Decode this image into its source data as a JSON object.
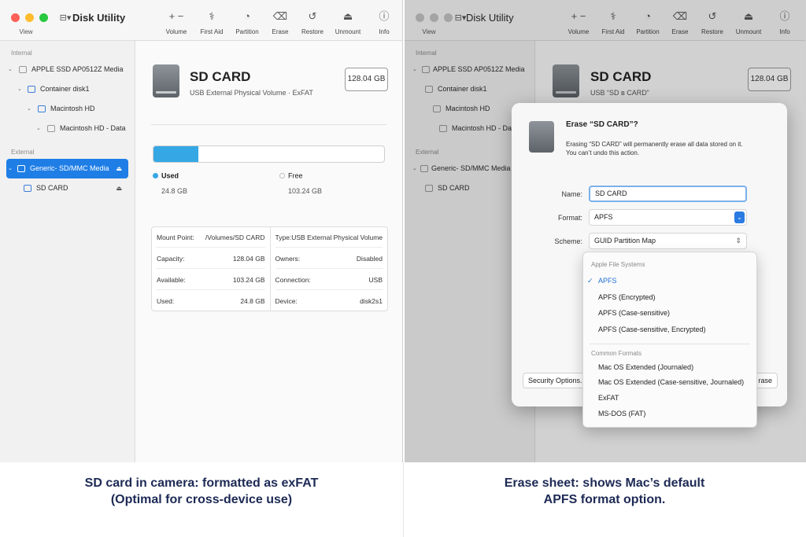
{
  "app": {
    "title": "Disk Utility",
    "view_label": "View",
    "toolbar": [
      {
        "label": "Volume",
        "icon": "plus-minus-icon"
      },
      {
        "label": "First Aid",
        "icon": "stethoscope-icon"
      },
      {
        "label": "Partition",
        "icon": "pie-icon"
      },
      {
        "label": "Erase",
        "icon": "erase-icon"
      },
      {
        "label": "Restore",
        "icon": "restore-icon"
      },
      {
        "label": "Unmount",
        "icon": "unmount-icon"
      },
      {
        "label": "Info",
        "icon": "info-icon"
      }
    ]
  },
  "sidebar": {
    "internal_header": "Internal",
    "external_header": "External",
    "internal_items": [
      {
        "label": "APPLE SSD AP0512Z Media"
      },
      {
        "label": "Container disk1"
      },
      {
        "label": "Macintosh HD"
      },
      {
        "label": "Macintosh HD - Data"
      }
    ],
    "external_items": [
      {
        "label": "Generic- SD/MMC Media"
      },
      {
        "label": "SD CARD"
      }
    ],
    "right_truncated": {
      "external_item_1": "Generic- SD/MMC Media"
    }
  },
  "volume": {
    "name": "SD CARD",
    "subtitle": "USB External Physical Volume  ·  ExFAT",
    "subtitle_obscured": "USB “SD ʙ CARD”",
    "capacity_badge": "128.04 GB",
    "used_fraction": 0.194,
    "used_label": "Used",
    "used_value": "24.8 GB",
    "free_label": "Free",
    "free_value": "103.24 GB",
    "used_color": "#35a7e5",
    "free_color": "#e8e8e8"
  },
  "info": {
    "left": [
      {
        "k": "Mount Point:",
        "v": "/Volumes/SD CARD"
      },
      {
        "k": "Capacity:",
        "v": "128.04 GB"
      },
      {
        "k": "Available:",
        "v": "103.24 GB"
      },
      {
        "k": "Used:",
        "v": "24.8 GB"
      }
    ],
    "right": [
      {
        "k": "Type:",
        "v": "USB External Physical Volume"
      },
      {
        "k": "Owners:",
        "v": "Disabled"
      },
      {
        "k": "Connection:",
        "v": "USB"
      },
      {
        "k": "Device:",
        "v": "disk2s1"
      }
    ]
  },
  "erase_sheet": {
    "title": "Erase “SD CARD”?",
    "description": "Erasing “SD CARD” will permanently erase all data stored on it. You can’t undo this action.",
    "name_label": "Name:",
    "name_value": "SD CARD",
    "format_label": "Format:",
    "format_value": "APFS",
    "scheme_label": "Scheme:",
    "scheme_value": "GUID Partition Map",
    "security_button": "Security Options...",
    "erase_button": "Erase",
    "erase_button_visible": "rase"
  },
  "format_menu": {
    "apple_header": "Apple File Systems",
    "apple_items": [
      "APFS",
      "APFS (Encrypted)",
      "APFS (Case-sensitive)",
      "APFS (Case-sensitive, Encrypted)"
    ],
    "common_header": "Common Formats",
    "common_items": [
      "Mac OS Extended (Journaled)",
      "Mac OS Extended (Case-sensitive, Journaled)",
      "ExFAT",
      "MS-DOS (FAT)"
    ],
    "checked_item": "APFS"
  },
  "captions": {
    "left_line1": "SD card in camera: formatted as exFAT",
    "left_line2": "(Optimal for cross-device use)",
    "right_line1": "Erase sheet: shows Mac’s default",
    "right_line2": "APFS format option."
  }
}
